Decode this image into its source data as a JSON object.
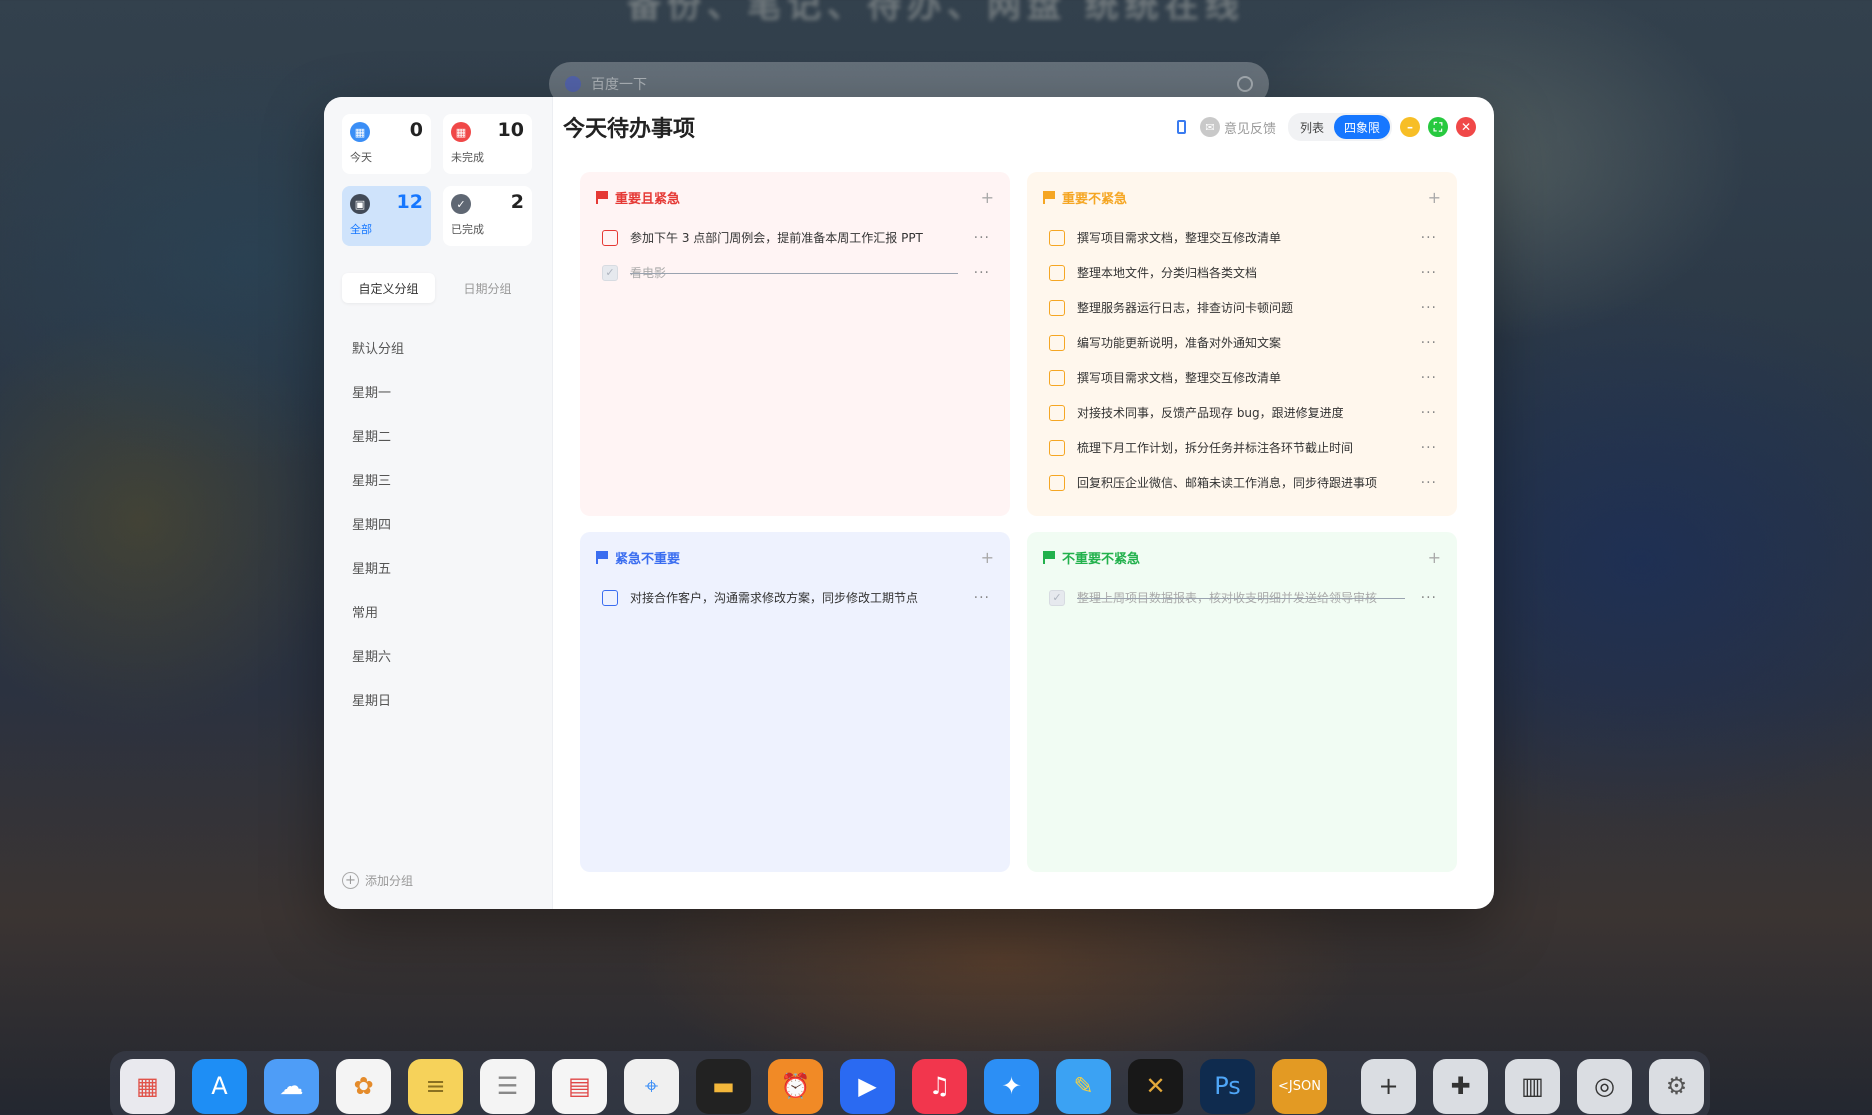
{
  "background": {
    "headline": "备份、笔记、待办、网盘 统统在线",
    "search_placeholder": "百度一下"
  },
  "window": {
    "title": "今天待办事项",
    "feedback_label": "意见反馈",
    "view_list": "列表",
    "view_quadrant": "四象限"
  },
  "sidebar": {
    "stats": [
      {
        "label": "今天",
        "count": "0",
        "color": "#3a8ef6",
        "icon": "calendar-icon"
      },
      {
        "label": "未完成",
        "count": "10",
        "color": "#f04848",
        "icon": "calendar-icon"
      },
      {
        "label": "全部",
        "count": "12",
        "color": "#424a57",
        "icon": "inbox-icon"
      },
      {
        "label": "已完成",
        "count": "2",
        "color": "#5f6773",
        "icon": "check-icon"
      }
    ],
    "tabs": [
      "自定义分组",
      "日期分组"
    ],
    "groups": [
      "默认分组",
      "星期一",
      "星期二",
      "星期三",
      "星期四",
      "星期五",
      "常用",
      "星期六",
      "星期日"
    ],
    "add_group": "添加分组"
  },
  "quadrants": {
    "q1": {
      "title": "重要且紧急",
      "color": "#e53935",
      "tasks": [
        {
          "text": "参加下午 3 点部门周例会，提前准备本周工作汇报 PPT",
          "done": false
        },
        {
          "text": "看电影",
          "done": true
        }
      ]
    },
    "q2": {
      "title": "重要不紧急",
      "color": "#f5a623",
      "tasks": [
        {
          "text": "撰写项目需求文档，整理交互修改清单",
          "done": false
        },
        {
          "text": "整理本地文件，分类归档各类文档",
          "done": false
        },
        {
          "text": "整理服务器运行日志，排查访问卡顿问题",
          "done": false
        },
        {
          "text": "编写功能更新说明，准备对外通知文案",
          "done": false
        },
        {
          "text": "撰写项目需求文档，整理交互修改清单",
          "done": false
        },
        {
          "text": "对接技术同事，反馈产品现存 bug，跟进修复进度",
          "done": false
        },
        {
          "text": "梳理下月工作计划，拆分任务并标注各环节截止时间",
          "done": false
        },
        {
          "text": "回复积压企业微信、邮箱未读工作消息，同步待跟进事项",
          "done": false
        }
      ]
    },
    "q3": {
      "title": "紧急不重要",
      "color": "#3a6df0",
      "tasks": [
        {
          "text": "对接合作客户，沟通需求修改方案，同步修改工期节点",
          "done": false
        }
      ]
    },
    "q4": {
      "title": "不重要不紧急",
      "color": "#22b14c",
      "tasks": [
        {
          "text": "整理上周项目数据报表，核对收支明细并发送给领导审核",
          "done": true
        }
      ]
    }
  },
  "dock": {
    "apps": [
      {
        "name": "launchpad-icon",
        "bg": "#e9e9ee",
        "glyph": "▦",
        "fg": "#e0534a"
      },
      {
        "name": "app-store-icon",
        "bg": "#1e8ef5",
        "glyph": "A",
        "fg": "#fff"
      },
      {
        "name": "icloud-icon",
        "bg": "#4e9df7",
        "glyph": "☁",
        "fg": "#fff"
      },
      {
        "name": "photos-icon",
        "bg": "#f4f4f4",
        "glyph": "✿",
        "fg": "#e48b2b"
      },
      {
        "name": "notes-icon",
        "bg": "#f6d25a",
        "glyph": "≡",
        "fg": "#8a7020"
      },
      {
        "name": "reminders-icon",
        "bg": "#f4f4f4",
        "glyph": "☰",
        "fg": "#888"
      },
      {
        "name": "calendar-icon",
        "bg": "#f5f5f5",
        "glyph": "▤",
        "fg": "#e04848"
      },
      {
        "name": "maps-icon",
        "bg": "#f0f0f0",
        "glyph": "⌖",
        "fg": "#3a8ef6"
      },
      {
        "name": "wallet-icon",
        "bg": "#222222",
        "glyph": "▬",
        "fg": "#f3b73b"
      },
      {
        "name": "clock-icon",
        "bg": "#f18a26",
        "glyph": "⏰",
        "fg": "#fff"
      },
      {
        "name": "video-player-icon",
        "bg": "#2a6af2",
        "glyph": "▶",
        "fg": "#fff"
      },
      {
        "name": "music-icon",
        "bg": "#f2364d",
        "glyph": "♫",
        "fg": "#fff"
      },
      {
        "name": "safari-icon",
        "bg": "#2c8ff5",
        "glyph": "✦",
        "fg": "#fff"
      },
      {
        "name": "sketch-pen-icon",
        "bg": "#3ba2f3",
        "glyph": "✎",
        "fg": "#f5d142"
      },
      {
        "name": "code-diff-icon",
        "bg": "#181818",
        "glyph": "✕",
        "fg": "#e3a93a"
      },
      {
        "name": "photoshop-icon",
        "bg": "#0f2b4e",
        "glyph": "Ps",
        "fg": "#4fa6f7"
      },
      {
        "name": "json-icon",
        "bg": "#e39a23",
        "glyph": "<JSON",
        "fg": "#fff"
      },
      {
        "name": "add-icon",
        "bg": "#dadde2",
        "glyph": "+",
        "fg": "#333"
      },
      {
        "name": "plugin-icon",
        "bg": "#dadde2",
        "glyph": "✚",
        "fg": "#333"
      },
      {
        "name": "brush-icon",
        "bg": "#dadde2",
        "glyph": "▥",
        "fg": "#333"
      },
      {
        "name": "lock-icon",
        "bg": "#dadde2",
        "glyph": "◎",
        "fg": "#333"
      },
      {
        "name": "settings-icon",
        "bg": "#dadde2",
        "glyph": "⚙",
        "fg": "#555"
      }
    ]
  }
}
